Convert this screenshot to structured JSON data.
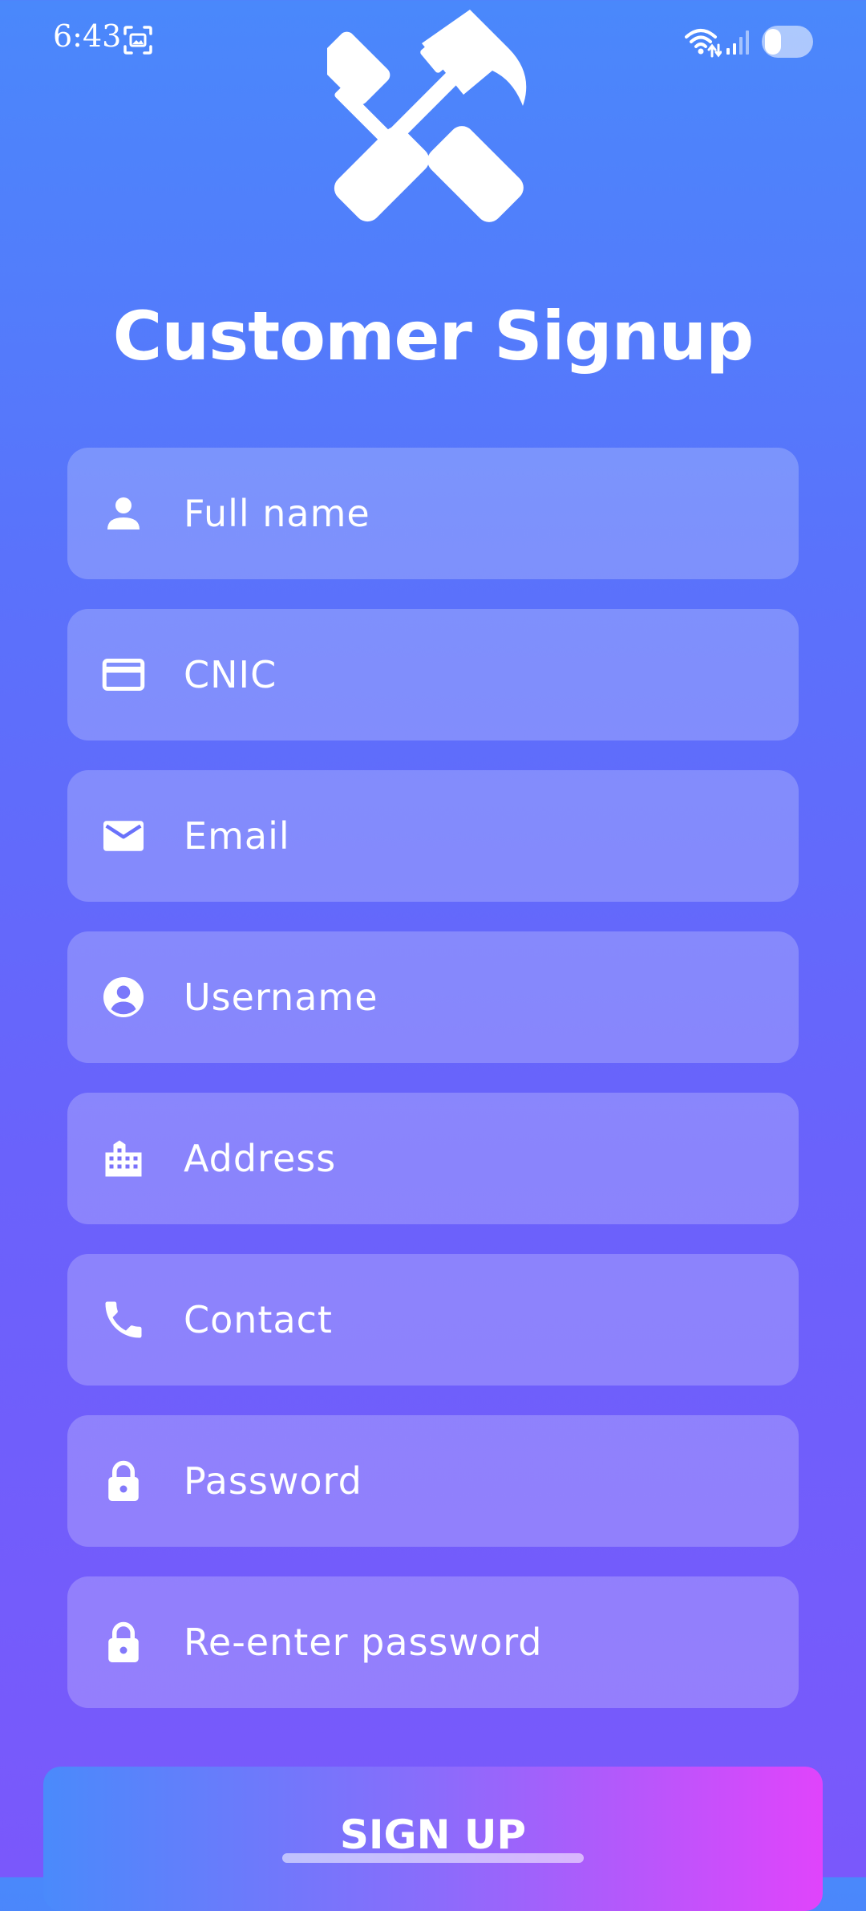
{
  "status_bar": {
    "time": "6:43",
    "icons": [
      "screenshot-icon",
      "wifi-icon",
      "signal-icon",
      "battery-icon"
    ],
    "battery_level": 0.35
  },
  "logo": {
    "icon": "hammer-wrench-crossed-icon"
  },
  "title": "Customer Signup",
  "form": {
    "fields": [
      {
        "name": "full-name",
        "icon": "person-icon",
        "placeholder": "Full name"
      },
      {
        "name": "cnic",
        "icon": "credit-card-icon",
        "placeholder": "CNIC"
      },
      {
        "name": "email",
        "icon": "mail-icon",
        "placeholder": "Email"
      },
      {
        "name": "username",
        "icon": "account-circle-icon",
        "placeholder": "Username"
      },
      {
        "name": "address",
        "icon": "building-icon",
        "placeholder": "Address"
      },
      {
        "name": "contact",
        "icon": "phone-icon",
        "placeholder": "Contact"
      },
      {
        "name": "password",
        "icon": "lock-icon",
        "placeholder": "Password"
      },
      {
        "name": "reenter-password",
        "icon": "lock-icon",
        "placeholder": "Re-enter password"
      }
    ]
  },
  "signup_button": {
    "label": "SIGN UP"
  },
  "colors": {
    "background_top": "#4a88fb",
    "background_bottom": "#7a58fb",
    "field_fill": "rgba(255,255,255,0.22)",
    "button_gradient_start": "#4a8afb",
    "button_gradient_end": "#e044fb",
    "text": "#ffffff"
  }
}
